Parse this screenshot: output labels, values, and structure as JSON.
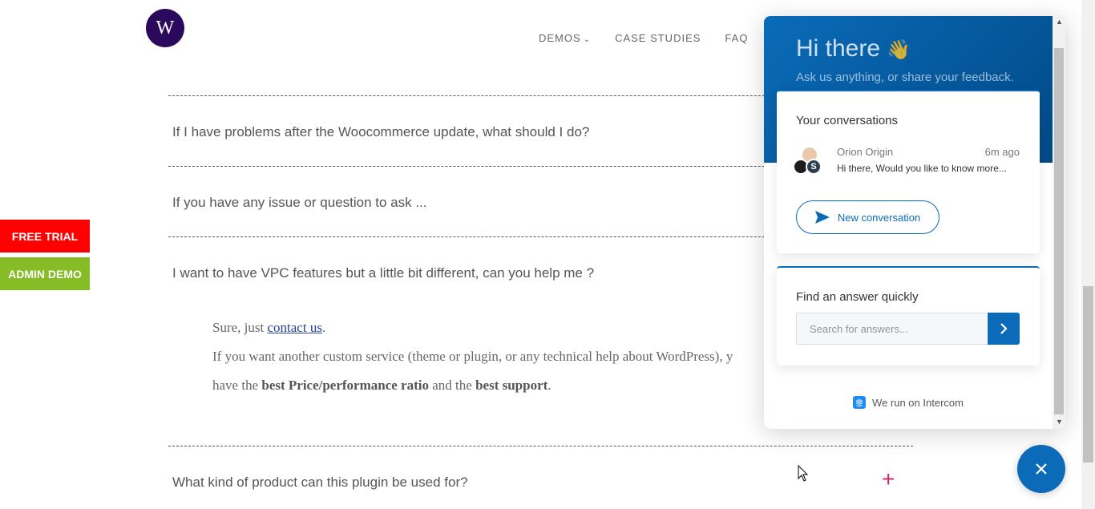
{
  "header": {
    "logo_letter": "W",
    "nav": [
      {
        "label": "DEMOS",
        "has_dropdown": true
      },
      {
        "label": "CASE STUDIES"
      },
      {
        "label": "FAQ"
      }
    ]
  },
  "faq": {
    "questions": [
      "If I have problems after the Woocommerce update, what should I do?",
      "If you have any issue or question to ask ...",
      "I want to have VPC features but a little bit different, can you help me ?",
      "What kind of product can this plugin be used for?"
    ],
    "answer": {
      "line1_prefix": "Sure, just ",
      "line1_link": "contact us",
      "line1_suffix": ".",
      "line2": "If you want another custom service (theme or plugin, or any technical help about WordPress), y",
      "line3_a": "have the ",
      "line3_b": "best Price/performance ratio",
      "line3_c": " and the ",
      "line3_d": "best support",
      "line3_e": "."
    },
    "expand_symbol": "+"
  },
  "side_buttons": {
    "free_trial": "FREE TRIAL",
    "admin_demo": "ADMIN DEMO"
  },
  "messenger": {
    "greeting": "Hi there",
    "greeting_emoji": "👋",
    "subgreeting": "Ask us anything, or share your feedback.",
    "conversations": {
      "title": "Your conversations",
      "items": [
        {
          "name": "Orion Origin",
          "time": "6m ago",
          "preview": "Hi there, Would you like to know more..."
        }
      ],
      "new_button": "New conversation"
    },
    "search": {
      "title": "Find an answer quickly",
      "placeholder": "Search for answers..."
    },
    "powered_by": "We run on Intercom"
  },
  "colors": {
    "accent": "#0b6bb8",
    "free_trial": "#ff0000",
    "admin_demo": "#86bc25",
    "logo": "#2b0a5e",
    "plus": "#d7266e"
  }
}
